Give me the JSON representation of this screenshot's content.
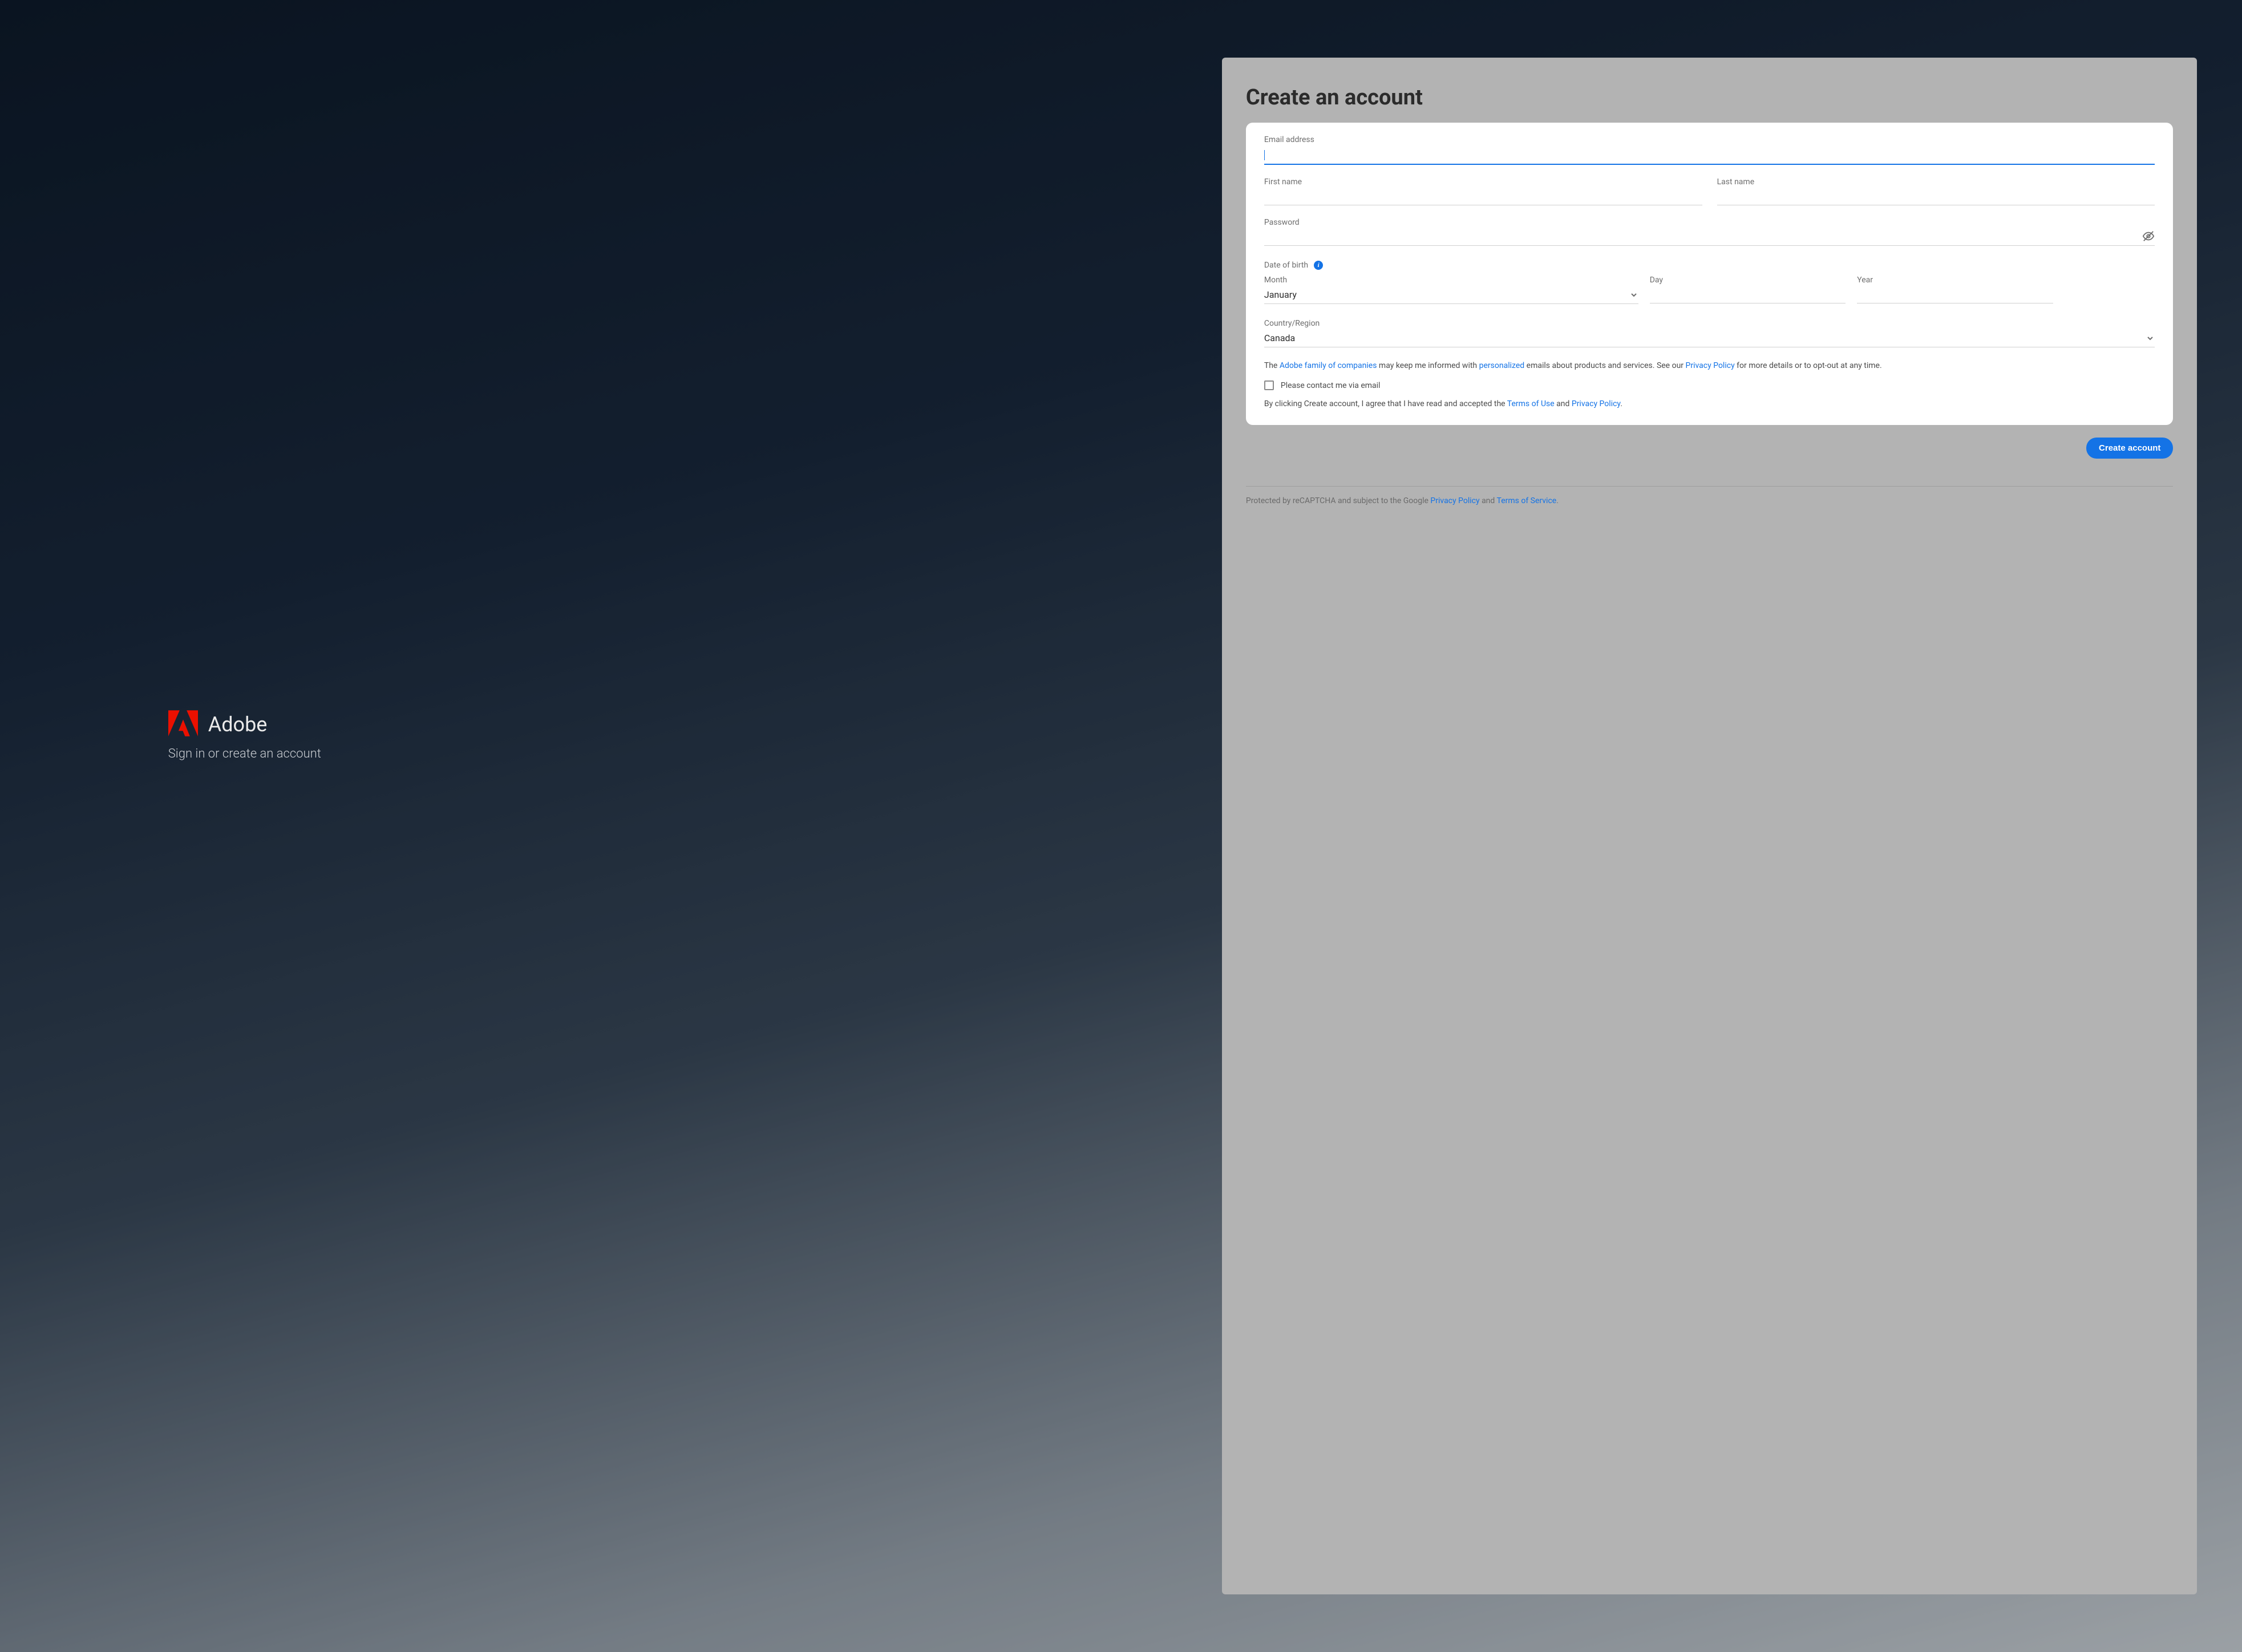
{
  "brand": {
    "name": "Adobe",
    "subtitle": "Sign in or create an account"
  },
  "panel": {
    "title": "Create an account"
  },
  "form": {
    "email_label": "Email address",
    "first_name_label": "First name",
    "last_name_label": "Last name",
    "password_label": "Password",
    "dob_label": "Date of birth",
    "month_label": "Month",
    "month_value": "January",
    "day_label": "Day",
    "year_label": "Year",
    "country_label": "Country/Region",
    "country_value": "Canada"
  },
  "legal": {
    "line1_a": "The ",
    "link_family": "Adobe family of companies",
    "line1_b": " may keep me informed with ",
    "link_personalized": "personalized",
    "line1_c": " emails about products and services. See our ",
    "link_privacy": "Privacy Policy",
    "line1_d": " for more details or to opt-out at any time.",
    "checkbox_label": "Please contact me via email",
    "line2_a": "By clicking Create account, I agree that I have read and accepted the ",
    "link_tou": "Terms of Use",
    "line2_b": " and ",
    "link_privacy2": "Privacy Policy",
    "line2_c": "."
  },
  "submit_label": "Create account",
  "footer": {
    "text_a": "Protected by reCAPTCHA and subject to the Google ",
    "link_privacy": "Privacy Policy",
    "text_b": " and ",
    "link_tos": "Terms of Service",
    "text_c": "."
  }
}
